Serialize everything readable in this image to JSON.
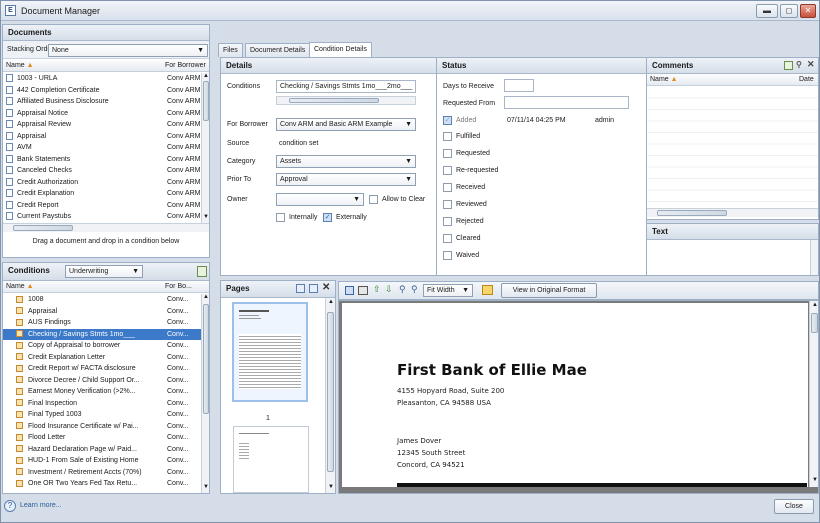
{
  "app": {
    "title": "Document Manager",
    "icon_letter": "E",
    "min": "▬",
    "max": "◻",
    "close": "✕"
  },
  "documents": {
    "header": "Documents",
    "stacking_label": "Stacking Order",
    "stacking_value": "None",
    "col_name": "Name",
    "col_for": "For Borrower",
    "rows": [
      {
        "name": "1003 - URLA",
        "for": "Conv ARM"
      },
      {
        "name": "442 Completion Certificate",
        "for": "Conv ARM"
      },
      {
        "name": "Affiliated Business Disclosure",
        "for": "Conv ARM"
      },
      {
        "name": "Appraisal Notice",
        "for": "Conv ARM"
      },
      {
        "name": "Appraisal Review",
        "for": "Conv ARM"
      },
      {
        "name": "Appraisal",
        "for": "Conv ARM"
      },
      {
        "name": "AVM",
        "for": "Conv ARM"
      },
      {
        "name": "Bank Statements",
        "for": "Conv ARM"
      },
      {
        "name": "Canceled Checks",
        "for": "Conv ARM"
      },
      {
        "name": "Credit Authorization",
        "for": "Conv ARM"
      },
      {
        "name": "Credit Explanation",
        "for": "Conv ARM"
      },
      {
        "name": "Credit Report",
        "for": "Conv ARM"
      },
      {
        "name": "Current Paystubs",
        "for": "Conv ARM"
      }
    ],
    "drag_hint": "Drag a document and drop in a condition below"
  },
  "conditions": {
    "header": "Conditions",
    "filter": "Underwriting",
    "col_name": "Name",
    "col_for": "For Bo...",
    "rows": [
      {
        "name": "1008",
        "for": "Conv..."
      },
      {
        "name": "Appraisal",
        "for": "Conv..."
      },
      {
        "name": "AUS Findings",
        "for": "Conv..."
      },
      {
        "name": "Checking / Savings Stmts  1mo___",
        "for": "Conv..."
      },
      {
        "name": "Copy of Appraisal to borrower",
        "for": "Conv..."
      },
      {
        "name": "Credit Explanation Letter",
        "for": "Conv..."
      },
      {
        "name": "Credit Report w/ FACTA disclosure",
        "for": "Conv..."
      },
      {
        "name": "Divorce Decree / Child Support Or...",
        "for": "Conv..."
      },
      {
        "name": "Earnest Money Verification (>2%...",
        "for": "Conv..."
      },
      {
        "name": "Final Inspection",
        "for": "Conv..."
      },
      {
        "name": "Final Typed 1003",
        "for": "Conv..."
      },
      {
        "name": "Flood Insurance Certificate w/ Pai...",
        "for": "Conv..."
      },
      {
        "name": "Flood Letter",
        "for": "Conv..."
      },
      {
        "name": "Hazard Declaration Page w/ Paid...",
        "for": "Conv..."
      },
      {
        "name": "HUD-1 From Sale of Existing Home",
        "for": "Conv..."
      },
      {
        "name": "Investment / Retirement Accts (70%)",
        "for": "Conv..."
      },
      {
        "name": "One OR Two Years Fed Tax Retu...",
        "for": "Conv..."
      }
    ],
    "selected_index": 3
  },
  "learn_more": "Learn more...",
  "tabs": [
    "Files",
    "Document Details",
    "Condition Details"
  ],
  "details": {
    "header": "Details",
    "conditions_label": "Conditions",
    "conditions_value": "Checking / Savings Stmts  1mo___2mo___",
    "for_borrower_label": "For Borrower",
    "for_borrower_value": "Conv ARM and Basic ARM Example",
    "source_label": "Source",
    "source_value": "condition set",
    "category_label": "Category",
    "category_value": "Assets",
    "prior_to_label": "Prior To",
    "prior_to_value": "Approval",
    "owner_label": "Owner",
    "owner_value": "",
    "allow_clear": "Allow to Clear",
    "internally": "Internally",
    "externally": "Externally"
  },
  "status": {
    "header": "Status",
    "days_label": "Days to Receive",
    "days_value": "",
    "requested_from_label": "Requested From",
    "requested_from_value": "",
    "added_label": "Added",
    "added_date": "07/11/14 04:25 PM",
    "added_by": "admin",
    "items": [
      "Fulfilled",
      "Requested",
      "Re-requested",
      "Received",
      "Reviewed",
      "Rejected",
      "Cleared",
      "Waived"
    ]
  },
  "comments": {
    "header": "Comments",
    "col_name": "Name",
    "col_date": "Date"
  },
  "text_panel": {
    "header": "Text"
  },
  "pages": {
    "header": "Pages",
    "page_number": "1"
  },
  "viewer": {
    "zoom": "Fit Width",
    "view_original": "View in Original Format",
    "bank_name": "First Bank of Ellie Mae",
    "address1": "4155 Hopyard Road, Suite 200",
    "address2": "Pleasanton, CA 94588 USA",
    "recipient": "James Dover",
    "street": "12345 South Street",
    "city": "Concord, CA 94521"
  },
  "footer": {
    "close": "Close"
  },
  "colors": {
    "selection": "#3d79c9",
    "panel_border": "#9eb0c6"
  }
}
